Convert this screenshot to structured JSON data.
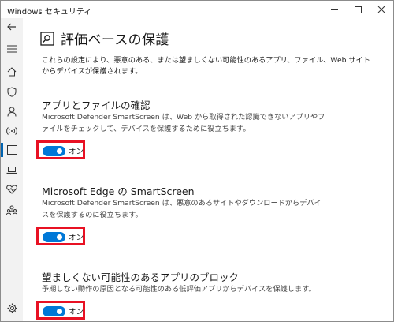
{
  "window": {
    "title": "Windows セキュリティ"
  },
  "nav": {
    "items": [
      {
        "icon": "back-arrow-icon"
      },
      {
        "icon": "hamburger-menu-icon"
      },
      {
        "icon": "home-icon"
      },
      {
        "icon": "shield-icon"
      },
      {
        "icon": "account-person-icon"
      },
      {
        "icon": "wireless-signal-icon"
      },
      {
        "icon": "app-browser-control-icon",
        "active": true
      },
      {
        "icon": "device-laptop-icon"
      },
      {
        "icon": "heart-health-icon"
      },
      {
        "icon": "family-group-icon"
      },
      {
        "icon": "gear-icon"
      }
    ]
  },
  "page": {
    "title": "評価ベースの保護",
    "intro": "これらの設定により、悪意のある、または望ましくない可能性のあるアプリ、ファイル、Web サイトからデバイスが保護されます。"
  },
  "sections": [
    {
      "title": "アプリとファイルの確認",
      "description": "Microsoft Defender SmartScreen は、Web から取得された認識できないアプリやファイルをチェックして、デバイスを保護するために役立ちます。",
      "toggle_label": "オン",
      "toggle_on": true
    },
    {
      "title": "Microsoft Edge の SmartScreen",
      "description": "Microsoft Defender SmartScreen は、悪意のあるサイトやダウンロードからデバイスを保護するのに役立ちます。",
      "toggle_label": "オン",
      "toggle_on": true
    },
    {
      "title": "望ましくない可能性のあるアプリのブロック",
      "description": "予期しない動作の原因となる可能性のある低評価アプリからデバイスを保護します。",
      "toggle_label": "オン",
      "toggle_on": true
    }
  ],
  "colors": {
    "accent": "#0078d7",
    "highlight": "#e81123",
    "rail_bg": "#f2f2f2"
  }
}
